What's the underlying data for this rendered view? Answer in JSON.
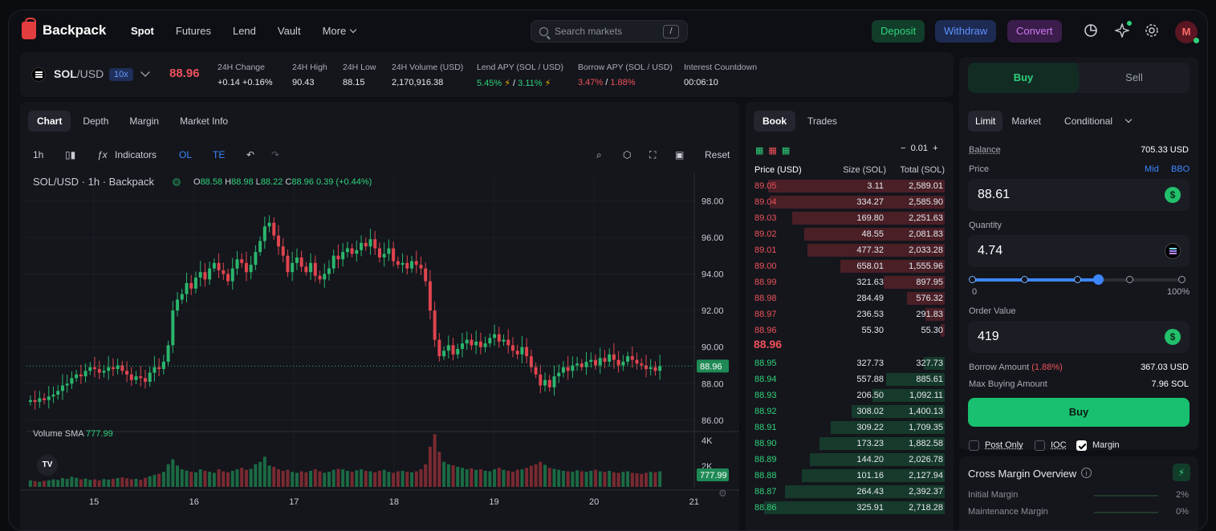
{
  "header": {
    "logo": "Backpack",
    "nav": [
      {
        "label": "Spot",
        "active": true
      },
      {
        "label": "Futures",
        "active": false
      },
      {
        "label": "Lend",
        "active": false
      },
      {
        "label": "Vault",
        "active": false
      },
      {
        "label": "More",
        "active": false
      }
    ],
    "search_placeholder": "Search markets",
    "search_shortcut": "/",
    "deposit": "Deposit",
    "withdraw": "Withdraw",
    "convert": "Convert",
    "avatar_initial": "M"
  },
  "ticker": {
    "base": "SOL",
    "sep": "/",
    "quote": "USD",
    "leverage": "10x",
    "last_price": "88.96",
    "stats": [
      {
        "label": "24H Change",
        "value": "+0.14 +0.16%",
        "color": "green"
      },
      {
        "label": "24H High",
        "value": "90.43"
      },
      {
        "label": "24H Low",
        "value": "88.15"
      },
      {
        "label": "24H Volume (USD)",
        "value": "2,170,916.38"
      }
    ],
    "lend_apy_label": "Lend APY (SOL / USD)",
    "lend_apy_sol": "5.45%",
    "lend_apy_usd": "3.11%",
    "borrow_apy_label": "Borrow APY (SOL / USD)",
    "borrow_apy_sol": "3.47%",
    "borrow_apy_usd": "1.88%",
    "countdown_label": "Interest Countdown",
    "countdown_value": "00:06:10"
  },
  "chart_panel": {
    "tabs": [
      {
        "label": "Chart",
        "active": true
      },
      {
        "label": "Depth",
        "active": false
      },
      {
        "label": "Margin",
        "active": false
      },
      {
        "label": "Market Info",
        "active": false
      }
    ],
    "interval": "1h",
    "indicators": "Indicators",
    "ol": "OL",
    "te": "TE",
    "reset": "Reset",
    "legend_title": "SOL/USD · 1h · Backpack",
    "ohlc": {
      "o": "88.58",
      "h": "88.98",
      "l": "88.22",
      "c": "88.96",
      "chg": "0.39 (+0.44%)"
    },
    "volume_label": "Volume SMA",
    "volume_value": "777.99",
    "volume_tag": "777.99",
    "price_tag": "88.96",
    "vol_ticks": [
      "4K",
      "2K"
    ]
  },
  "chart_data": {
    "type": "candlestick",
    "price_ticks": [
      98.0,
      96.0,
      94.0,
      92.0,
      90.0,
      88.0,
      86.0
    ],
    "price_tick_labels": [
      "98.00",
      "96.00",
      "94.00",
      "92.00",
      "90.00",
      "88.00",
      "86.00"
    ],
    "x_labels": [
      "15",
      "16",
      "17",
      "18",
      "19",
      "20",
      "21"
    ],
    "ylim": [
      85.6,
      99.2
    ],
    "closes": [
      87.1,
      87.0,
      87.2,
      87.1,
      87.3,
      87.4,
      87.6,
      87.9,
      88.0,
      88.3,
      88.5,
      88.4,
      88.7,
      88.9,
      88.8,
      88.6,
      88.7,
      88.9,
      88.8,
      89.0,
      88.7,
      88.5,
      88.2,
      88.4,
      88.3,
      88.1,
      88.6,
      88.9,
      88.8,
      89.2,
      90.1,
      92.0,
      92.6,
      92.9,
      93.5,
      93.2,
      93.8,
      94.1,
      93.7,
      94.3,
      94.6,
      94.2,
      94.0,
      93.6,
      94.3,
      94.8,
      94.6,
      94.1,
      94.5,
      95.2,
      95.8,
      96.6,
      96.8,
      96.1,
      95.5,
      95.0,
      94.1,
      94.6,
      94.9,
      94.4,
      94.1,
      94.6,
      93.9,
      93.7,
      94.0,
      94.3,
      95.0,
      94.8,
      95.2,
      95.4,
      95.1,
      95.3,
      95.7,
      95.5,
      95.9,
      95.4,
      94.9,
      95.1,
      95.4,
      94.7,
      94.5,
      94.6,
      94.3,
      94.7,
      94.5,
      94.3,
      93.6,
      92.0,
      90.4,
      89.5,
      89.8,
      90.1,
      89.6,
      89.9,
      90.2,
      90.4,
      90.1,
      90.3,
      90.0,
      90.2,
      90.5,
      90.7,
      90.3,
      90.4,
      90.1,
      89.8,
      89.6,
      90.0,
      89.5,
      88.9,
      88.5,
      87.9,
      88.2,
      87.8,
      88.4,
      88.6,
      88.9,
      88.7,
      89.0,
      89.1,
      88.9,
      89.2,
      89.3,
      89.0,
      89.4,
      89.2,
      89.6,
      89.3,
      89.0,
      89.2,
      89.5,
      89.3,
      89.1,
      89.0,
      88.8,
      88.9,
      88.7,
      88.96
    ],
    "volumes": [
      260,
      230,
      200,
      240,
      260,
      300,
      280,
      350,
      320,
      400,
      360,
      300,
      330,
      280,
      300,
      260,
      310,
      290,
      320,
      350,
      380,
      340,
      300,
      320,
      280,
      360,
      420,
      480,
      520,
      600,
      900,
      1100,
      850,
      700,
      650,
      600,
      580,
      700,
      640,
      600,
      560,
      700,
      620,
      580,
      640,
      700,
      760,
      680,
      720,
      900,
      1000,
      1200,
      850,
      800,
      700,
      640,
      680,
      600,
      560,
      620,
      580,
      640,
      700,
      620,
      560,
      600,
      680,
      720,
      700,
      640,
      600,
      660,
      700,
      640,
      620,
      580,
      640,
      680,
      600,
      560,
      620,
      640,
      600,
      580,
      620,
      700,
      900,
      1600,
      2100,
      1400,
      1000,
      900,
      860,
      800,
      760,
      700,
      740,
      680,
      700,
      640,
      620,
      700,
      760,
      680,
      640,
      600,
      680,
      700,
      760,
      840,
      900,
      1000,
      880,
      760,
      720,
      680,
      640,
      620,
      600,
      660,
      620,
      600,
      640,
      680,
      620,
      600,
      640,
      580,
      560,
      600,
      620,
      560,
      540,
      520,
      560,
      600,
      580,
      620
    ]
  },
  "orderbook": {
    "tabs": [
      {
        "label": "Book",
        "active": true
      },
      {
        "label": "Trades",
        "active": false
      }
    ],
    "tick_size": "0.01",
    "headers": [
      "Price (USD)",
      "Size (SOL)",
      "Total (SOL)"
    ],
    "asks": [
      {
        "price": "89.05",
        "size": "3.11",
        "total": "2,589.01",
        "depth": 0.93
      },
      {
        "price": "89.04",
        "size": "334.27",
        "total": "2,585.90",
        "depth": 0.92
      },
      {
        "price": "89.03",
        "size": "169.80",
        "total": "2,251.63",
        "depth": 0.8
      },
      {
        "price": "89.02",
        "size": "48.55",
        "total": "2,081.83",
        "depth": 0.74
      },
      {
        "price": "89.01",
        "size": "477.32",
        "total": "2,033.28",
        "depth": 0.72
      },
      {
        "price": "89.00",
        "size": "658.01",
        "total": "1,555.96",
        "depth": 0.55
      },
      {
        "price": "88.99",
        "size": "321.63",
        "total": "897.95",
        "depth": 0.32
      },
      {
        "price": "88.98",
        "size": "284.49",
        "total": "576.32",
        "depth": 0.2
      },
      {
        "price": "88.97",
        "size": "236.53",
        "total": "291.83",
        "depth": 0.1
      },
      {
        "price": "88.96",
        "size": "55.30",
        "total": "55.30",
        "depth": 0.02
      }
    ],
    "mid_price": "88.96",
    "bids": [
      {
        "price": "88.95",
        "size": "327.73",
        "total": "327.73",
        "depth": 0.11
      },
      {
        "price": "88.94",
        "size": "557.88",
        "total": "885.61",
        "depth": 0.31
      },
      {
        "price": "88.93",
        "size": "206.50",
        "total": "1,092.11",
        "depth": 0.38
      },
      {
        "price": "88.92",
        "size": "308.02",
        "total": "1,400.13",
        "depth": 0.49
      },
      {
        "price": "88.91",
        "size": "309.22",
        "total": "1,709.35",
        "depth": 0.6
      },
      {
        "price": "88.90",
        "size": "173.23",
        "total": "1,882.58",
        "depth": 0.66
      },
      {
        "price": "88.89",
        "size": "144.20",
        "total": "2,026.78",
        "depth": 0.71
      },
      {
        "price": "88.88",
        "size": "101.16",
        "total": "2,127.94",
        "depth": 0.75
      },
      {
        "price": "88.87",
        "size": "264.43",
        "total": "2,392.37",
        "depth": 0.84
      },
      {
        "price": "88.86",
        "size": "325.91",
        "total": "2,718.28",
        "depth": 0.95
      }
    ]
  },
  "trade": {
    "buy_tab": "Buy",
    "sell_tab": "Sell",
    "order_tabs": [
      "Limit",
      "Market",
      "Conditional"
    ],
    "balance_label": "Balance",
    "balance_value": "705.33 USD",
    "price_label": "Price",
    "mid": "Mid",
    "bbo": "BBO",
    "price_value": "88.61",
    "quantity_label": "Quantity",
    "quantity_value": "4.74",
    "slider_min": "0",
    "slider_max": "100%",
    "slider_fraction": 0.6,
    "order_value_label": "Order Value",
    "order_value": "419",
    "borrow_label": "Borrow Amount",
    "borrow_rate": "(1.88%)",
    "borrow_value": "367.03 USD",
    "max_label": "Max Buying Amount",
    "max_value": "7.96 SOL",
    "submit": "Buy",
    "post_only": "Post Only",
    "ioc": "IOC",
    "margin": "Margin"
  },
  "cross_margin": {
    "title": "Cross Margin Overview",
    "rows": [
      {
        "label": "Initial Margin",
        "value": "2%"
      },
      {
        "label": "Maintenance Margin",
        "value": "0%"
      }
    ]
  }
}
